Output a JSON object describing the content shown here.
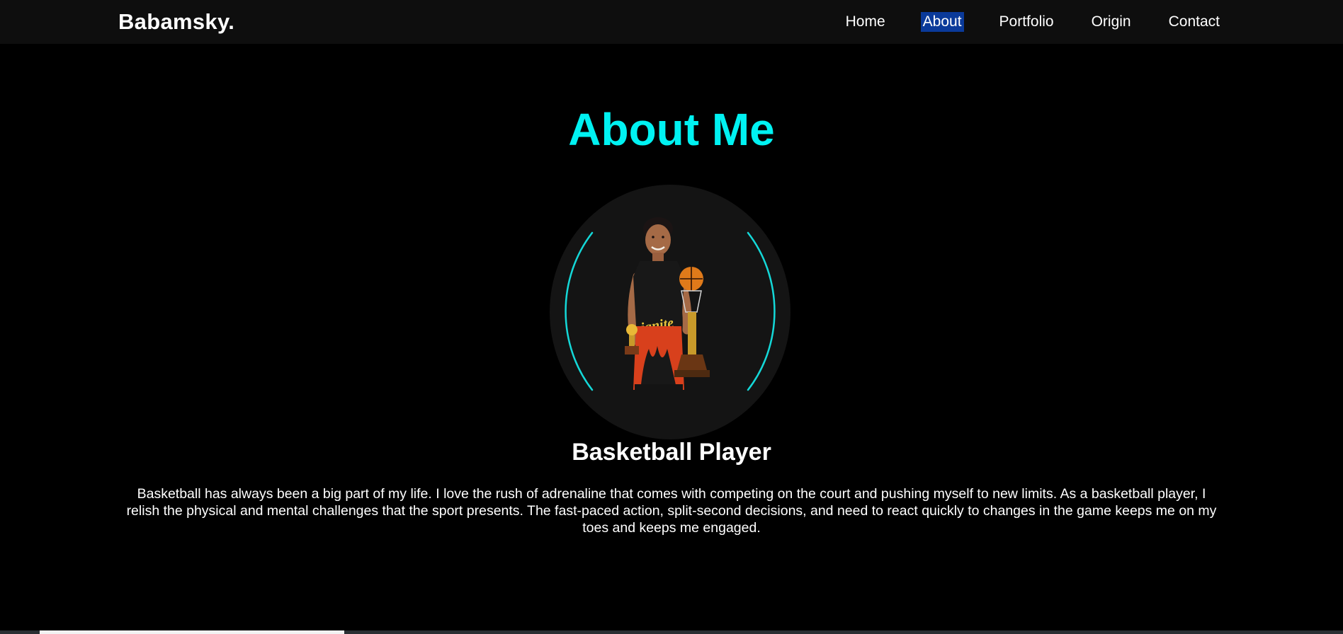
{
  "site": {
    "logo": "Babamsky."
  },
  "nav": {
    "items": [
      {
        "label": "Home"
      },
      {
        "label": "About"
      },
      {
        "label": "Portfolio"
      },
      {
        "label": "Origin"
      },
      {
        "label": "Contact"
      }
    ],
    "active": "About"
  },
  "about": {
    "title": "About Me",
    "role": "Basketball Player",
    "description": "Basketball has always been a big part of my life. I love the rush of adrenaline that comes with competing on the court and pushing myself to new limits. As a basketball player, I relish the physical and mental challenges that the sport presents. The fast-paced action, split-second decisions, and need to react quickly to changes in the game keeps me on my toes and keeps me engaged."
  },
  "colors": {
    "accent": "#00f2f2",
    "nav_bg": "#0e0e0e",
    "active_highlight": "#0a3a9a",
    "page_bg": "#000000",
    "jersey": "#d8401c"
  },
  "icons": {
    "avatar": "player-photo"
  }
}
